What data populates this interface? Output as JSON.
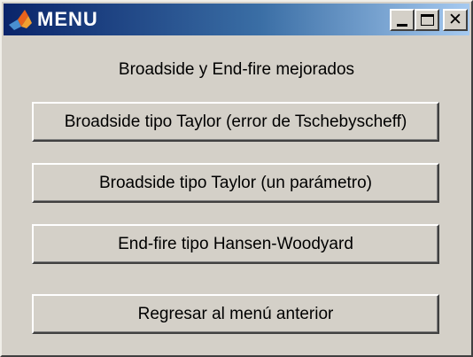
{
  "window": {
    "title": "MENU",
    "icon": "matlab-logo-icon",
    "controls": {
      "minimize": "minimize-icon",
      "maximize": "maximize-icon",
      "close": "close-icon",
      "close_glyph": "✕"
    }
  },
  "heading": "Broadside y End-fire mejorados",
  "buttons": [
    {
      "label": "Broadside tipo Taylor (error de Tschebyscheff)"
    },
    {
      "label": "Broadside tipo Taylor (un parámetro)"
    },
    {
      "label": "End-fire tipo Hansen-Woodyard"
    },
    {
      "label": "Regresar al menú anterior"
    }
  ],
  "colors": {
    "title_bar_start": "#0a246a",
    "title_bar_end": "#a6caf0",
    "window_face": "#d4d0c8"
  }
}
